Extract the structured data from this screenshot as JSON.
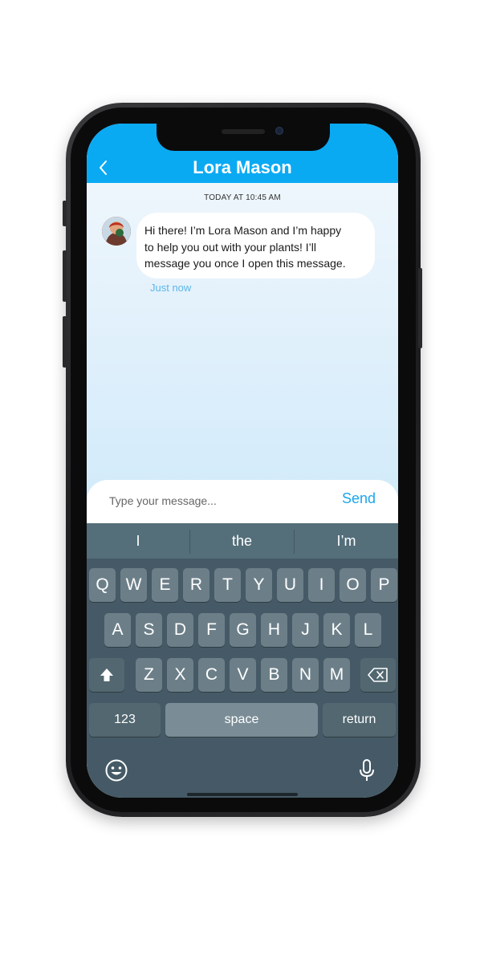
{
  "header": {
    "title": "Lora Mason",
    "back_icon": "chevron-left-icon"
  },
  "chat": {
    "timestamp": "TODAY AT 10:45 AM",
    "messages": [
      {
        "sender": "Lora Mason",
        "lines": [
          "Hi there! I’m Lora Mason and I’m happy",
          "to help you out with your plants! I’ll",
          "message you once I open this message."
        ],
        "time": "Just now"
      }
    ]
  },
  "composer": {
    "placeholder": "Type your message...",
    "value": "",
    "send_label": "Send"
  },
  "keyboard": {
    "suggestions": [
      "I",
      "the",
      "I’m"
    ],
    "row1": [
      "Q",
      "W",
      "E",
      "R",
      "T",
      "Y",
      "U",
      "I",
      "O",
      "P"
    ],
    "row2": [
      "A",
      "S",
      "D",
      "F",
      "G",
      "H",
      "J",
      "K",
      "L"
    ],
    "row3": [
      "Z",
      "X",
      "C",
      "V",
      "B",
      "N",
      "M"
    ],
    "numbers_label": "123",
    "space_label": "space",
    "return_label": "return",
    "shift_icon": "shift-icon",
    "delete_icon": "backspace-icon",
    "emoji_icon": "emoji-icon",
    "mic_icon": "microphone-icon"
  },
  "colors": {
    "header": "#0aaaf3",
    "send": "#1ba7ec",
    "keyboard_bg": "#455a66",
    "key_bg": "#6c7f89"
  }
}
